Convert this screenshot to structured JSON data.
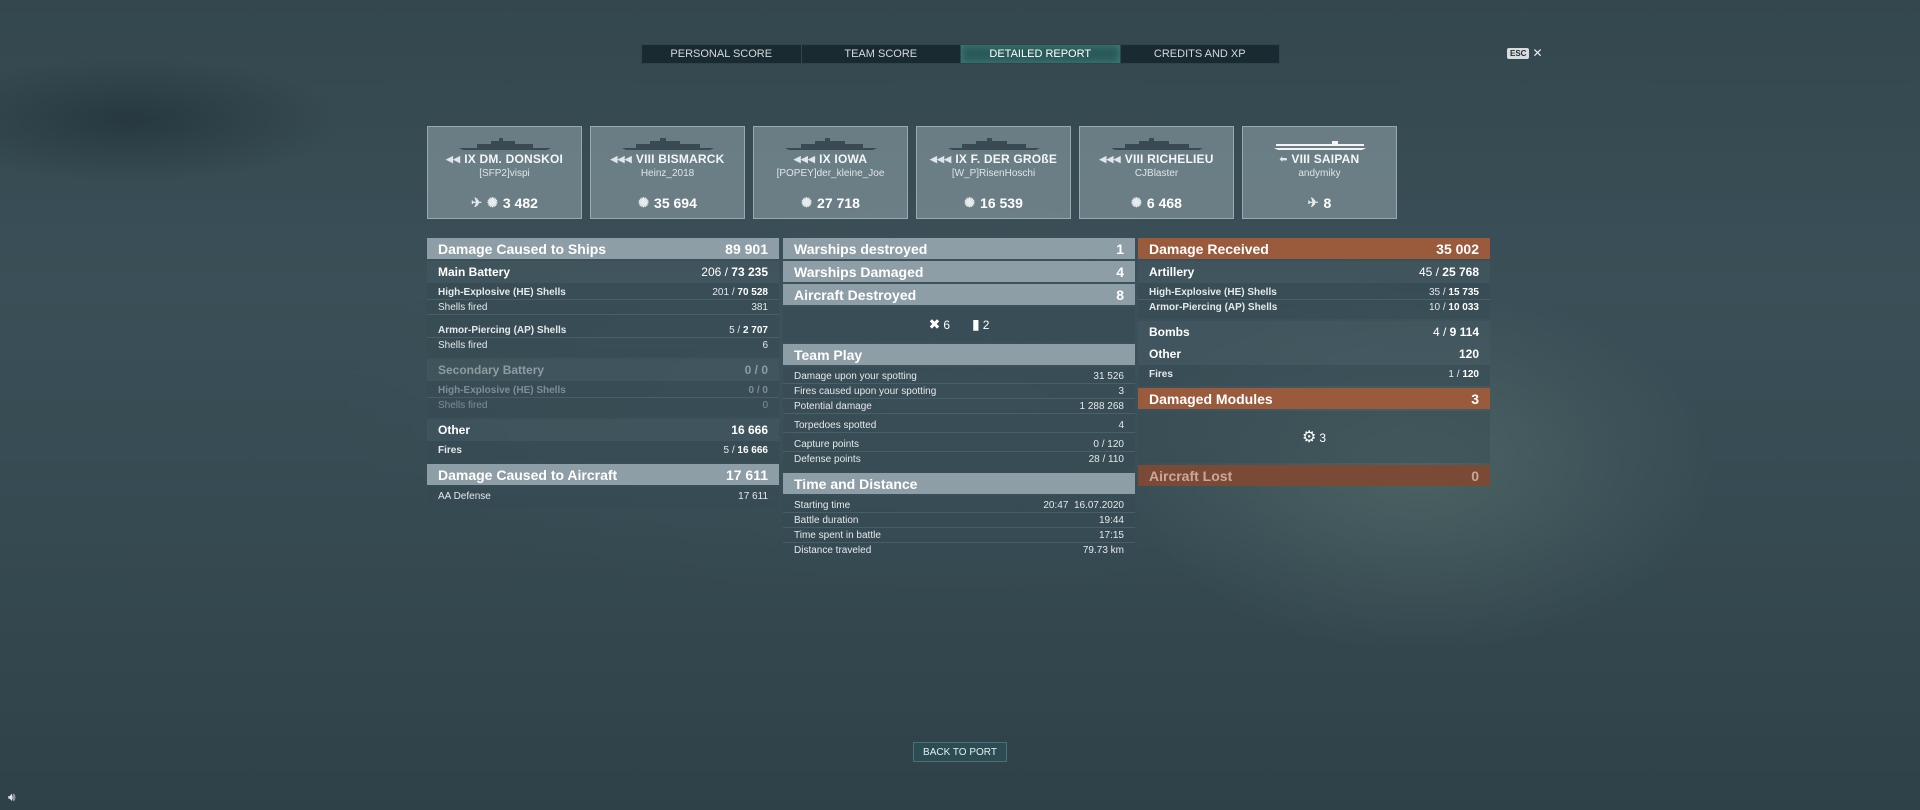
{
  "tabs": [
    {
      "label": "PERSONAL SCORE"
    },
    {
      "label": "TEAM SCORE"
    },
    {
      "label": "DETAILED REPORT"
    },
    {
      "label": "CREDITS AND XP"
    }
  ],
  "esc": {
    "key": "ESC",
    "close": "✕"
  },
  "ships": [
    {
      "name": "IX DM. DONSKOI",
      "player": "[SFP2]vispi",
      "value": "3 482",
      "stat_icon": "bomber-icon"
    },
    {
      "name": "VIII BISMARCK",
      "player": "Heinz_2018",
      "value": "35 694",
      "stat_icon": "explosion-icon"
    },
    {
      "name": "IX IOWA",
      "player": "[POPEY]der_kleine_Joe",
      "value": "27 718",
      "stat_icon": "explosion-icon"
    },
    {
      "name": "IX F. DER GROßE",
      "player": "[W_P]RisenHoschi",
      "value": "16 539",
      "stat_icon": "explosion-icon"
    },
    {
      "name": "VIII RICHELIEU",
      "player": "CJBlaster",
      "value": "6 468",
      "stat_icon": "explosion-icon"
    },
    {
      "name": "VIII SAIPAN",
      "player": "andymiky",
      "value": "8",
      "stat_icon": "plane-destroyed-icon"
    }
  ],
  "col1": {
    "damage_ships": {
      "label": "Damage Caused to Ships",
      "value": "89 901"
    },
    "main_battery": {
      "label": "Main Battery",
      "hits": "206 / ",
      "value": "73 235"
    },
    "he": {
      "label": "High-Explosive (HE) Shells",
      "hits": "201 / ",
      "value": "70 528"
    },
    "he_fired": {
      "label": "Shells fired",
      "value": "381"
    },
    "ap": {
      "label": "Armor-Piercing (AP) Shells",
      "hits": "5 / ",
      "value": "2 707"
    },
    "ap_fired": {
      "label": "Shells fired",
      "value": "6"
    },
    "secondary": {
      "label": "Secondary Battery",
      "value": "0 / 0"
    },
    "sec_he": {
      "label": "High-Explosive (HE) Shells",
      "value": "0 / 0"
    },
    "sec_fired": {
      "label": "Shells fired",
      "value": "0"
    },
    "other": {
      "label": "Other",
      "value": "16 666"
    },
    "fires": {
      "label": "Fires",
      "hits": "5 / ",
      "value": "16 666"
    },
    "damage_aircraft": {
      "label": "Damage Caused to Aircraft",
      "value": "17 611"
    },
    "aa": {
      "label": "AA Defense",
      "value": "17 611"
    }
  },
  "col2": {
    "warships_destroyed": {
      "label": "Warships destroyed",
      "value": "1"
    },
    "warships_damaged": {
      "label": "Warships Damaged",
      "value": "4"
    },
    "aircraft_destroyed": {
      "label": "Aircraft Destroyed",
      "value": "8"
    },
    "icons": {
      "shot_down": "6",
      "other": "2"
    },
    "team_play": {
      "label": "Team Play"
    },
    "tp_rows": [
      {
        "label": "Damage upon your spotting",
        "value": "31 526"
      },
      {
        "label": "Fires caused upon your spotting",
        "value": "3"
      },
      {
        "label": "Potential damage",
        "value": "1 288 268"
      },
      {
        "label": "Torpedoes spotted",
        "value": "4"
      },
      {
        "label": "Capture points",
        "value": "0 / 120"
      },
      {
        "label": "Defense points",
        "value": "28 / 110"
      }
    ],
    "time_distance": {
      "label": "Time and Distance"
    },
    "td_rows": [
      {
        "label": "Starting time",
        "value": "20:47  16.07.2020"
      },
      {
        "label": "Battle duration",
        "value": "19:44"
      },
      {
        "label": "Time spent in battle",
        "value": "17:15"
      },
      {
        "label": "Distance traveled",
        "value": "79.73 km"
      }
    ]
  },
  "col3": {
    "damage_received": {
      "label": "Damage Received",
      "value": "35 002"
    },
    "artillery": {
      "label": "Artillery",
      "hits": "45 / ",
      "value": "25 768"
    },
    "he": {
      "label": "High-Explosive (HE) Shells",
      "hits": "35 / ",
      "value": "15 735"
    },
    "ap": {
      "label": "Armor-Piercing (AP) Shells",
      "hits": "10 / ",
      "value": "10 033"
    },
    "bombs": {
      "label": "Bombs",
      "hits": "4 / ",
      "value": "9 114"
    },
    "other": {
      "label": "Other",
      "value": "120"
    },
    "fires": {
      "label": "Fires",
      "hits": "1 / ",
      "value": "120"
    },
    "damaged_modules": {
      "label": "Damaged Modules",
      "value": "3"
    },
    "module_count": "3",
    "aircraft_lost": {
      "label": "Aircraft Lost",
      "value": "0"
    }
  },
  "back_button": "BACK TO PORT"
}
